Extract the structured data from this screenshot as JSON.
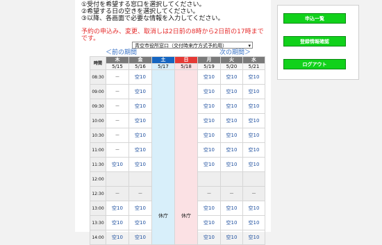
{
  "instructions": [
    "①受付を希望する窓口を選択してください。",
    "②希望する日の空きを選択してください。",
    "③以降、各画面で必要な情報を入力してください。"
  ],
  "notice": "予約の申込み、変更、取消しは2日前の8時から2日前の17時までです。",
  "window_select": {
    "value": "青空市役所窓口（交付時来庁方式予約用）"
  },
  "nav": {
    "prev": "＜前の期間",
    "next": "次の期間＞"
  },
  "calendar": {
    "time_header": "時間",
    "days": [
      {
        "dow": "木",
        "date": "5/15"
      },
      {
        "dow": "金",
        "date": "5/16"
      },
      {
        "dow": "土",
        "date": "5/17"
      },
      {
        "dow": "日",
        "date": "5/18"
      },
      {
        "dow": "月",
        "date": "5/19"
      },
      {
        "dow": "火",
        "date": "5/20"
      },
      {
        "dow": "水",
        "date": "5/21"
      }
    ],
    "closed_label": "休庁",
    "rows": [
      {
        "time": "08:30",
        "cells": [
          "－",
          "空10",
          "",
          "",
          "空10",
          "空10",
          "空10"
        ]
      },
      {
        "time": "09:00",
        "cells": [
          "－",
          "空10",
          "",
          "",
          "空10",
          "空10",
          "空10"
        ]
      },
      {
        "time": "09:30",
        "cells": [
          "－",
          "空10",
          "",
          "",
          "空10",
          "空10",
          "空10"
        ]
      },
      {
        "time": "10:00",
        "cells": [
          "－",
          "空10",
          "",
          "",
          "空10",
          "空10",
          "空10"
        ]
      },
      {
        "time": "10:30",
        "cells": [
          "－",
          "空10",
          "",
          "",
          "空10",
          "空10",
          "空10"
        ]
      },
      {
        "time": "11:00",
        "cells": [
          "－",
          "空10",
          "",
          "",
          "空10",
          "空10",
          "空10"
        ]
      },
      {
        "time": "11:30",
        "cells": [
          "空10",
          "空10",
          "",
          "",
          "空10",
          "空10",
          "空10"
        ]
      },
      {
        "time": "12:00",
        "cells": [
          "",
          "",
          "",
          "",
          "",
          "",
          ""
        ]
      },
      {
        "time": "12:30",
        "cells": [
          "",
          "",
          "",
          "",
          "",
          "",
          ""
        ]
      },
      {
        "time": "13:00",
        "cells": [
          "空10",
          "空10",
          "",
          "",
          "空10",
          "空10",
          "空10"
        ]
      },
      {
        "time": "13:30",
        "cells": [
          "空10",
          "空10",
          "",
          "",
          "空10",
          "空10",
          "空10"
        ]
      },
      {
        "time": "14:00",
        "cells": [
          "空10",
          "空10",
          "",
          "",
          "空10",
          "空10",
          "空10"
        ]
      }
    ],
    "lunch_dash": "－"
  },
  "sidebar": {
    "buttons": [
      "申込一覧",
      "登録情報確認",
      "ログアウト"
    ]
  },
  "colors": {
    "button_green": "#11d11b",
    "saturday_blue": "#1565c0",
    "sunday_red": "#e53935",
    "notice_red": "#e52b2b"
  }
}
